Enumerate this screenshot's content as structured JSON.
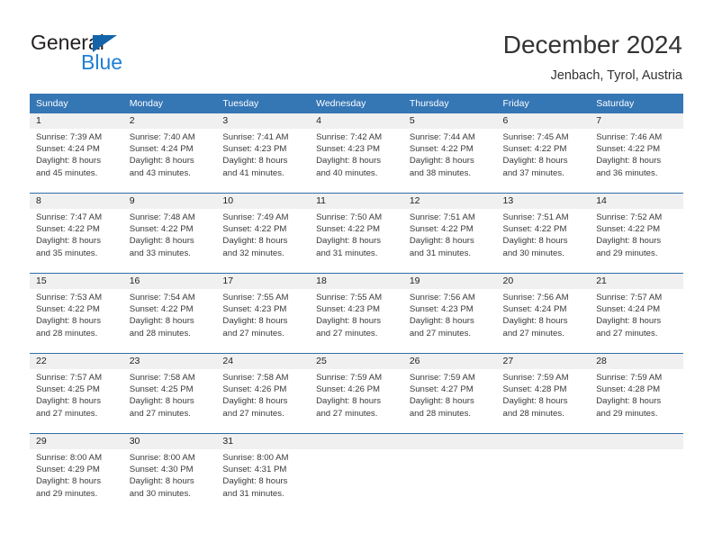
{
  "brand": {
    "name_part1": "General",
    "name_part2": "Blue",
    "triangle_icon": "triangle-icon",
    "color_dark": "#231f20",
    "color_blue": "#1e7fd4"
  },
  "header": {
    "title": "December 2024",
    "location": "Jenbach, Tyrol, Austria"
  },
  "theme": {
    "header_bg": "#3576b5",
    "row_divider": "#2f6da8",
    "daynum_bg": "#f0f0f0",
    "text": "#3a3a3a"
  },
  "weekdays": [
    "Sunday",
    "Monday",
    "Tuesday",
    "Wednesday",
    "Thursday",
    "Friday",
    "Saturday"
  ],
  "weeks": [
    [
      {
        "day": "1",
        "sunrise": "Sunrise: 7:39 AM",
        "sunset": "Sunset: 4:24 PM",
        "daylight1": "Daylight: 8 hours",
        "daylight2": "and 45 minutes."
      },
      {
        "day": "2",
        "sunrise": "Sunrise: 7:40 AM",
        "sunset": "Sunset: 4:24 PM",
        "daylight1": "Daylight: 8 hours",
        "daylight2": "and 43 minutes."
      },
      {
        "day": "3",
        "sunrise": "Sunrise: 7:41 AM",
        "sunset": "Sunset: 4:23 PM",
        "daylight1": "Daylight: 8 hours",
        "daylight2": "and 41 minutes."
      },
      {
        "day": "4",
        "sunrise": "Sunrise: 7:42 AM",
        "sunset": "Sunset: 4:23 PM",
        "daylight1": "Daylight: 8 hours",
        "daylight2": "and 40 minutes."
      },
      {
        "day": "5",
        "sunrise": "Sunrise: 7:44 AM",
        "sunset": "Sunset: 4:22 PM",
        "daylight1": "Daylight: 8 hours",
        "daylight2": "and 38 minutes."
      },
      {
        "day": "6",
        "sunrise": "Sunrise: 7:45 AM",
        "sunset": "Sunset: 4:22 PM",
        "daylight1": "Daylight: 8 hours",
        "daylight2": "and 37 minutes."
      },
      {
        "day": "7",
        "sunrise": "Sunrise: 7:46 AM",
        "sunset": "Sunset: 4:22 PM",
        "daylight1": "Daylight: 8 hours",
        "daylight2": "and 36 minutes."
      }
    ],
    [
      {
        "day": "8",
        "sunrise": "Sunrise: 7:47 AM",
        "sunset": "Sunset: 4:22 PM",
        "daylight1": "Daylight: 8 hours",
        "daylight2": "and 35 minutes."
      },
      {
        "day": "9",
        "sunrise": "Sunrise: 7:48 AM",
        "sunset": "Sunset: 4:22 PM",
        "daylight1": "Daylight: 8 hours",
        "daylight2": "and 33 minutes."
      },
      {
        "day": "10",
        "sunrise": "Sunrise: 7:49 AM",
        "sunset": "Sunset: 4:22 PM",
        "daylight1": "Daylight: 8 hours",
        "daylight2": "and 32 minutes."
      },
      {
        "day": "11",
        "sunrise": "Sunrise: 7:50 AM",
        "sunset": "Sunset: 4:22 PM",
        "daylight1": "Daylight: 8 hours",
        "daylight2": "and 31 minutes."
      },
      {
        "day": "12",
        "sunrise": "Sunrise: 7:51 AM",
        "sunset": "Sunset: 4:22 PM",
        "daylight1": "Daylight: 8 hours",
        "daylight2": "and 31 minutes."
      },
      {
        "day": "13",
        "sunrise": "Sunrise: 7:51 AM",
        "sunset": "Sunset: 4:22 PM",
        "daylight1": "Daylight: 8 hours",
        "daylight2": "and 30 minutes."
      },
      {
        "day": "14",
        "sunrise": "Sunrise: 7:52 AM",
        "sunset": "Sunset: 4:22 PM",
        "daylight1": "Daylight: 8 hours",
        "daylight2": "and 29 minutes."
      }
    ],
    [
      {
        "day": "15",
        "sunrise": "Sunrise: 7:53 AM",
        "sunset": "Sunset: 4:22 PM",
        "daylight1": "Daylight: 8 hours",
        "daylight2": "and 28 minutes."
      },
      {
        "day": "16",
        "sunrise": "Sunrise: 7:54 AM",
        "sunset": "Sunset: 4:22 PM",
        "daylight1": "Daylight: 8 hours",
        "daylight2": "and 28 minutes."
      },
      {
        "day": "17",
        "sunrise": "Sunrise: 7:55 AM",
        "sunset": "Sunset: 4:23 PM",
        "daylight1": "Daylight: 8 hours",
        "daylight2": "and 27 minutes."
      },
      {
        "day": "18",
        "sunrise": "Sunrise: 7:55 AM",
        "sunset": "Sunset: 4:23 PM",
        "daylight1": "Daylight: 8 hours",
        "daylight2": "and 27 minutes."
      },
      {
        "day": "19",
        "sunrise": "Sunrise: 7:56 AM",
        "sunset": "Sunset: 4:23 PM",
        "daylight1": "Daylight: 8 hours",
        "daylight2": "and 27 minutes."
      },
      {
        "day": "20",
        "sunrise": "Sunrise: 7:56 AM",
        "sunset": "Sunset: 4:24 PM",
        "daylight1": "Daylight: 8 hours",
        "daylight2": "and 27 minutes."
      },
      {
        "day": "21",
        "sunrise": "Sunrise: 7:57 AM",
        "sunset": "Sunset: 4:24 PM",
        "daylight1": "Daylight: 8 hours",
        "daylight2": "and 27 minutes."
      }
    ],
    [
      {
        "day": "22",
        "sunrise": "Sunrise: 7:57 AM",
        "sunset": "Sunset: 4:25 PM",
        "daylight1": "Daylight: 8 hours",
        "daylight2": "and 27 minutes."
      },
      {
        "day": "23",
        "sunrise": "Sunrise: 7:58 AM",
        "sunset": "Sunset: 4:25 PM",
        "daylight1": "Daylight: 8 hours",
        "daylight2": "and 27 minutes."
      },
      {
        "day": "24",
        "sunrise": "Sunrise: 7:58 AM",
        "sunset": "Sunset: 4:26 PM",
        "daylight1": "Daylight: 8 hours",
        "daylight2": "and 27 minutes."
      },
      {
        "day": "25",
        "sunrise": "Sunrise: 7:59 AM",
        "sunset": "Sunset: 4:26 PM",
        "daylight1": "Daylight: 8 hours",
        "daylight2": "and 27 minutes."
      },
      {
        "day": "26",
        "sunrise": "Sunrise: 7:59 AM",
        "sunset": "Sunset: 4:27 PM",
        "daylight1": "Daylight: 8 hours",
        "daylight2": "and 28 minutes."
      },
      {
        "day": "27",
        "sunrise": "Sunrise: 7:59 AM",
        "sunset": "Sunset: 4:28 PM",
        "daylight1": "Daylight: 8 hours",
        "daylight2": "and 28 minutes."
      },
      {
        "day": "28",
        "sunrise": "Sunrise: 7:59 AM",
        "sunset": "Sunset: 4:28 PM",
        "daylight1": "Daylight: 8 hours",
        "daylight2": "and 29 minutes."
      }
    ],
    [
      {
        "day": "29",
        "sunrise": "Sunrise: 8:00 AM",
        "sunset": "Sunset: 4:29 PM",
        "daylight1": "Daylight: 8 hours",
        "daylight2": "and 29 minutes."
      },
      {
        "day": "30",
        "sunrise": "Sunrise: 8:00 AM",
        "sunset": "Sunset: 4:30 PM",
        "daylight1": "Daylight: 8 hours",
        "daylight2": "and 30 minutes."
      },
      {
        "day": "31",
        "sunrise": "Sunrise: 8:00 AM",
        "sunset": "Sunset: 4:31 PM",
        "daylight1": "Daylight: 8 hours",
        "daylight2": "and 31 minutes."
      },
      {
        "day": "",
        "sunrise": "",
        "sunset": "",
        "daylight1": "",
        "daylight2": ""
      },
      {
        "day": "",
        "sunrise": "",
        "sunset": "",
        "daylight1": "",
        "daylight2": ""
      },
      {
        "day": "",
        "sunrise": "",
        "sunset": "",
        "daylight1": "",
        "daylight2": ""
      },
      {
        "day": "",
        "sunrise": "",
        "sunset": "",
        "daylight1": "",
        "daylight2": ""
      }
    ]
  ]
}
